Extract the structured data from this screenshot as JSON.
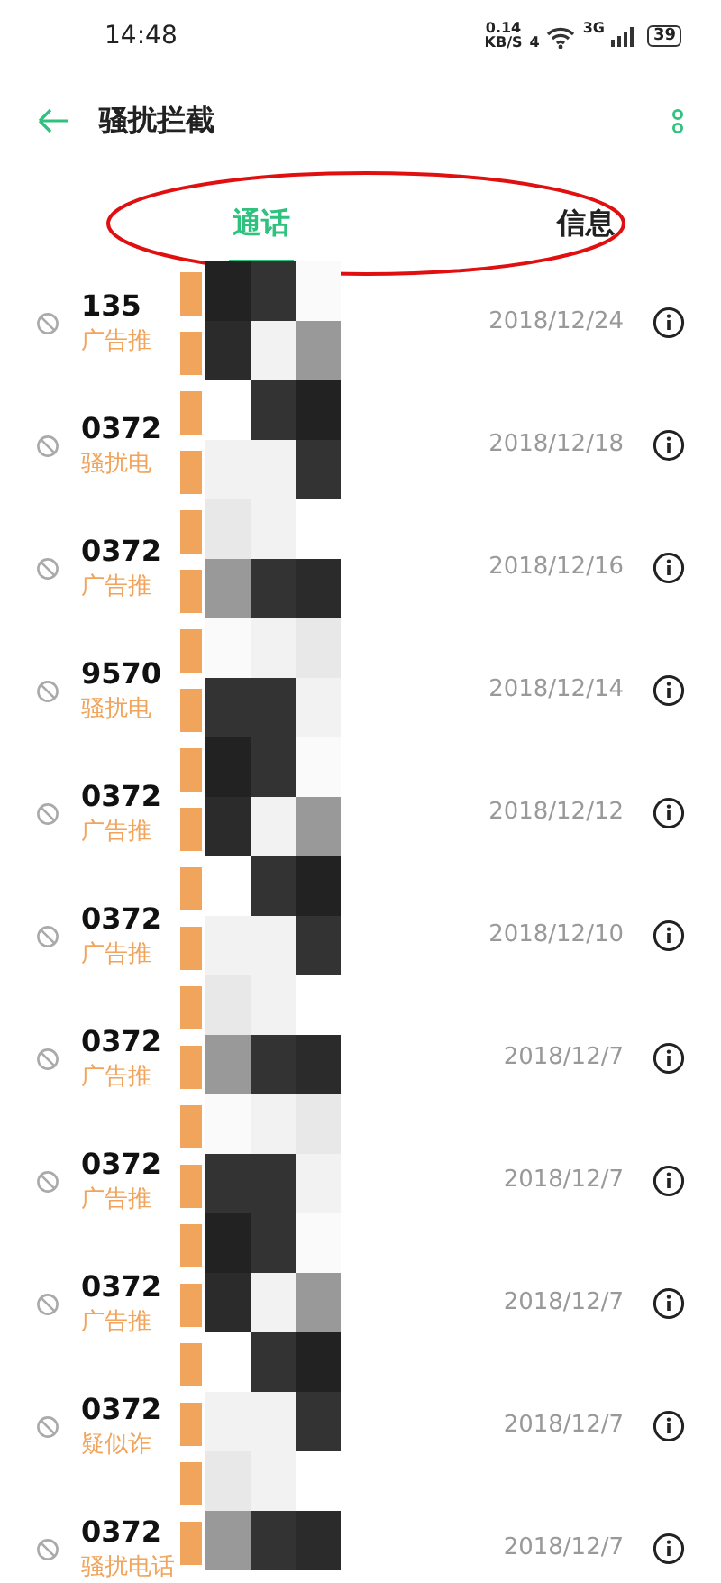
{
  "status_bar": {
    "time": "14:48",
    "net_speed": "0.14",
    "net_unit": "KB/S",
    "wifi_badge": "4",
    "signal_badge": "3G",
    "battery": "39"
  },
  "header": {
    "title": "骚扰拦截"
  },
  "tabs": [
    {
      "label": "通话",
      "selected": true
    },
    {
      "label": "信息",
      "selected": false
    }
  ],
  "calls": [
    {
      "number": "135",
      "tag": "广告推",
      "date": "2018/12/24"
    },
    {
      "number": "0372",
      "tag": "骚扰电",
      "date": "2018/12/18"
    },
    {
      "number": "0372",
      "tag": "广告推",
      "date": "2018/12/16"
    },
    {
      "number": "9570",
      "tag": "骚扰电",
      "date": "2018/12/14"
    },
    {
      "number": "0372",
      "tag": "广告推",
      "date": "2018/12/12"
    },
    {
      "number": "0372",
      "tag": "广告推",
      "date": "2018/12/10"
    },
    {
      "number": "0372",
      "tag": "广告推",
      "date": "2018/12/7"
    },
    {
      "number": "0372",
      "tag": "广告推",
      "date": "2018/12/7"
    },
    {
      "number": "0372",
      "tag": "广告推",
      "date": "2018/12/7"
    },
    {
      "number": "0372",
      "tag": "疑似诈",
      "date": "2018/12/7"
    },
    {
      "number": "0372",
      "tag": "骚扰电话",
      "date": "2018/12/7"
    }
  ]
}
